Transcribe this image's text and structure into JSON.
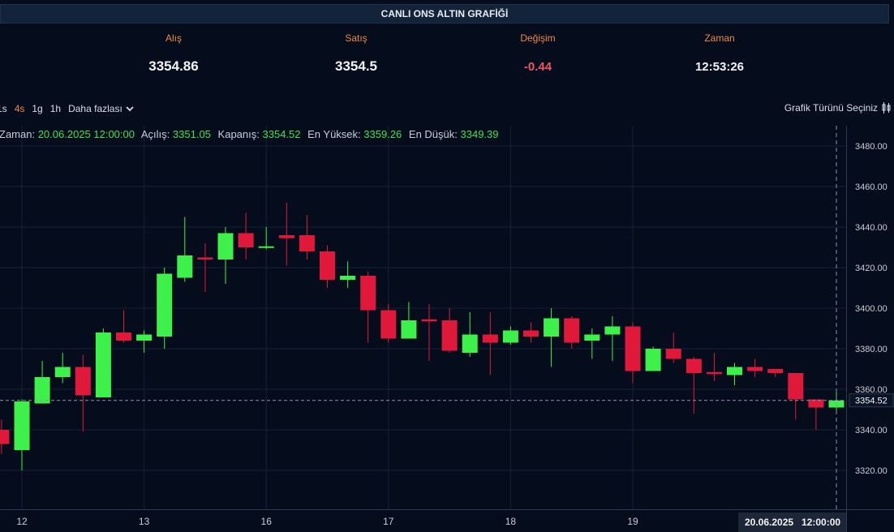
{
  "header": {
    "title": "CANLI ONS ALTIN GRAFİĞİ"
  },
  "stats": {
    "bid_label": "Alış",
    "bid_value": "3354.86",
    "ask_label": "Satış",
    "ask_value": "3354.5",
    "change_label": "Değişim",
    "change_value": "-0.44",
    "time_label": "Zaman",
    "time_value": "12:53:26"
  },
  "toolbar": {
    "intervals": [
      "1s",
      "4s",
      "1g",
      "1h"
    ],
    "active": "4s",
    "more_label": "Daha fazlası",
    "chart_type_label": "Grafik Türünü Seçiniz"
  },
  "ohlc": {
    "time_label": "Zaman:",
    "time_value": "20.06.2025 12:00:00",
    "open_label": "Açılış:",
    "open_value": "3351.05",
    "close_label": "Kapanış:",
    "close_value": "3354.52",
    "high_label": "En Yüksek:",
    "high_value": "3359.26",
    "low_label": "En Düşük:",
    "low_value": "3349.39"
  },
  "colors": {
    "up": "#3ef04a",
    "down": "#e0193a",
    "background": "#050d1c",
    "grid": "#142338"
  },
  "chart_data": {
    "type": "candlestick",
    "interval": "4s",
    "ylim": [
      3310,
      3490
    ],
    "yticks": [
      3320,
      3340,
      3360,
      3380,
      3400,
      3420,
      3440,
      3460,
      3480
    ],
    "xticks": [
      {
        "label": "12",
        "index": 1
      },
      {
        "label": "13",
        "index": 7
      },
      {
        "label": "16",
        "index": 13
      },
      {
        "label": "17",
        "index": 19
      },
      {
        "label": "18",
        "index": 25
      },
      {
        "label": "19",
        "index": 31
      }
    ],
    "last_price": "3354.52",
    "crosshair_date": "20.06.2025",
    "crosshair_time": "12:00:00",
    "candles": [
      {
        "o": 3340,
        "h": 3345,
        "l": 3328,
        "c": 3333
      },
      {
        "o": 3330,
        "h": 3355,
        "l": 3320,
        "c": 3354
      },
      {
        "o": 3353,
        "h": 3374,
        "l": 3353,
        "c": 3366
      },
      {
        "o": 3366,
        "h": 3378,
        "l": 3363,
        "c": 3371
      },
      {
        "o": 3371,
        "h": 3377,
        "l": 3339,
        "c": 3357
      },
      {
        "o": 3356,
        "h": 3390,
        "l": 3356,
        "c": 3388
      },
      {
        "o": 3388,
        "h": 3399,
        "l": 3383,
        "c": 3384
      },
      {
        "o": 3384,
        "h": 3389,
        "l": 3378,
        "c": 3387
      },
      {
        "o": 3386,
        "h": 3420,
        "l": 3380,
        "c": 3417
      },
      {
        "o": 3415,
        "h": 3445,
        "l": 3413,
        "c": 3426
      },
      {
        "o": 3425,
        "h": 3432,
        "l": 3408,
        "c": 3424
      },
      {
        "o": 3424,
        "h": 3440,
        "l": 3412,
        "c": 3437
      },
      {
        "o": 3437,
        "h": 3447,
        "l": 3424,
        "c": 3430
      },
      {
        "o": 3430,
        "h": 3440,
        "l": 3429,
        "c": 3430.5
      },
      {
        "o": 3436,
        "h": 3452,
        "l": 3421,
        "c": 3434.5
      },
      {
        "o": 3436,
        "h": 3446,
        "l": 3424,
        "c": 3428
      },
      {
        "o": 3428,
        "h": 3431,
        "l": 3410,
        "c": 3414
      },
      {
        "o": 3414,
        "h": 3423,
        "l": 3410,
        "c": 3416
      },
      {
        "o": 3416,
        "h": 3418,
        "l": 3383,
        "c": 3399
      },
      {
        "o": 3399,
        "h": 3402,
        "l": 3383,
        "c": 3385
      },
      {
        "o": 3385,
        "h": 3403,
        "l": 3385,
        "c": 3394
      },
      {
        "o": 3394.5,
        "h": 3402,
        "l": 3374,
        "c": 3393.5
      },
      {
        "o": 3394,
        "h": 3400,
        "l": 3378,
        "c": 3379
      },
      {
        "o": 3378,
        "h": 3398,
        "l": 3376,
        "c": 3387
      },
      {
        "o": 3387,
        "h": 3398,
        "l": 3367,
        "c": 3383
      },
      {
        "o": 3383,
        "h": 3391,
        "l": 3382,
        "c": 3389
      },
      {
        "o": 3389,
        "h": 3393,
        "l": 3383,
        "c": 3386
      },
      {
        "o": 3386,
        "h": 3400,
        "l": 3371,
        "c": 3395
      },
      {
        "o": 3395,
        "h": 3396,
        "l": 3380,
        "c": 3383
      },
      {
        "o": 3384,
        "h": 3390,
        "l": 3375,
        "c": 3387
      },
      {
        "o": 3387,
        "h": 3396,
        "l": 3374,
        "c": 3391
      },
      {
        "o": 3391,
        "h": 3393,
        "l": 3363,
        "c": 3369
      },
      {
        "o": 3369,
        "h": 3381,
        "l": 3369,
        "c": 3380
      },
      {
        "o": 3380,
        "h": 3388,
        "l": 3373,
        "c": 3375
      },
      {
        "o": 3375,
        "h": 3376,
        "l": 3348,
        "c": 3368
      },
      {
        "o": 3368.5,
        "h": 3378,
        "l": 3364,
        "c": 3367.5
      },
      {
        "o": 3367,
        "h": 3373,
        "l": 3362,
        "c": 3371
      },
      {
        "o": 3371,
        "h": 3375,
        "l": 3366,
        "c": 3369
      },
      {
        "o": 3370,
        "h": 3370,
        "l": 3366,
        "c": 3368
      },
      {
        "o": 3368,
        "h": 3368,
        "l": 3345,
        "c": 3355
      },
      {
        "o": 3355,
        "h": 3355,
        "l": 3340,
        "c": 3351
      },
      {
        "o": 3351,
        "h": 3359,
        "l": 3349,
        "c": 3354.5
      }
    ]
  }
}
